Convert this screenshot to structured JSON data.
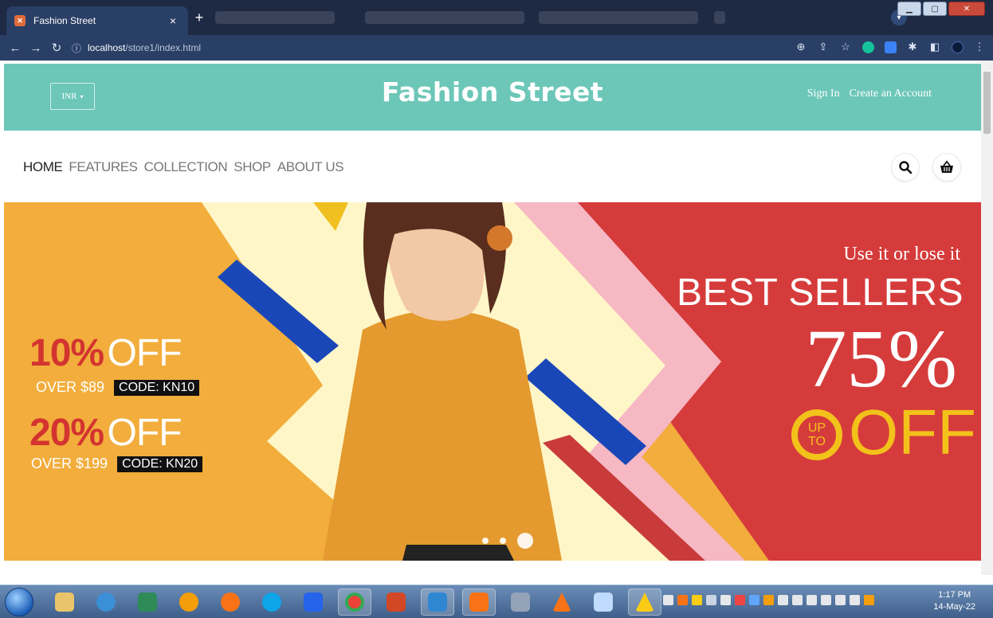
{
  "browser": {
    "tab_title": "Fashion Street",
    "tab_favicon": "xampp-icon",
    "url_host": "localhost",
    "url_path": "/store1/index.html"
  },
  "header": {
    "currency": "INR",
    "brand": "Fashion Street",
    "sign_in": "Sign In",
    "create_account": "Create an Account",
    "accent_color": "#6cc7b8"
  },
  "nav": {
    "items": [
      {
        "label": "HOME",
        "active": true
      },
      {
        "label": "FEATURES",
        "active": false
      },
      {
        "label": "COLLECTION",
        "active": false
      },
      {
        "label": "SHOP",
        "active": false
      },
      {
        "label": "ABOUT US",
        "active": false
      }
    ],
    "search_icon": "search-icon",
    "cart_icon": "basket-icon"
  },
  "banner": {
    "offer1_pct": "10%",
    "offer1_off": "OFF",
    "offer1_min": "OVER $89",
    "offer1_code": "CODE: KN10",
    "offer2_pct": "20%",
    "offer2_off": "OFF",
    "offer2_min": "OVER $199",
    "offer2_code": "CODE: KN20",
    "tagline": "Use it or lose it",
    "headline": "BEST SELLERS",
    "big_pct": "75%",
    "up": "UP",
    "to": "TO",
    "off": "OFF",
    "slides": 3,
    "active_slide": 3
  },
  "taskbar": {
    "time": "1:17 PM",
    "date": "14-May-22"
  }
}
